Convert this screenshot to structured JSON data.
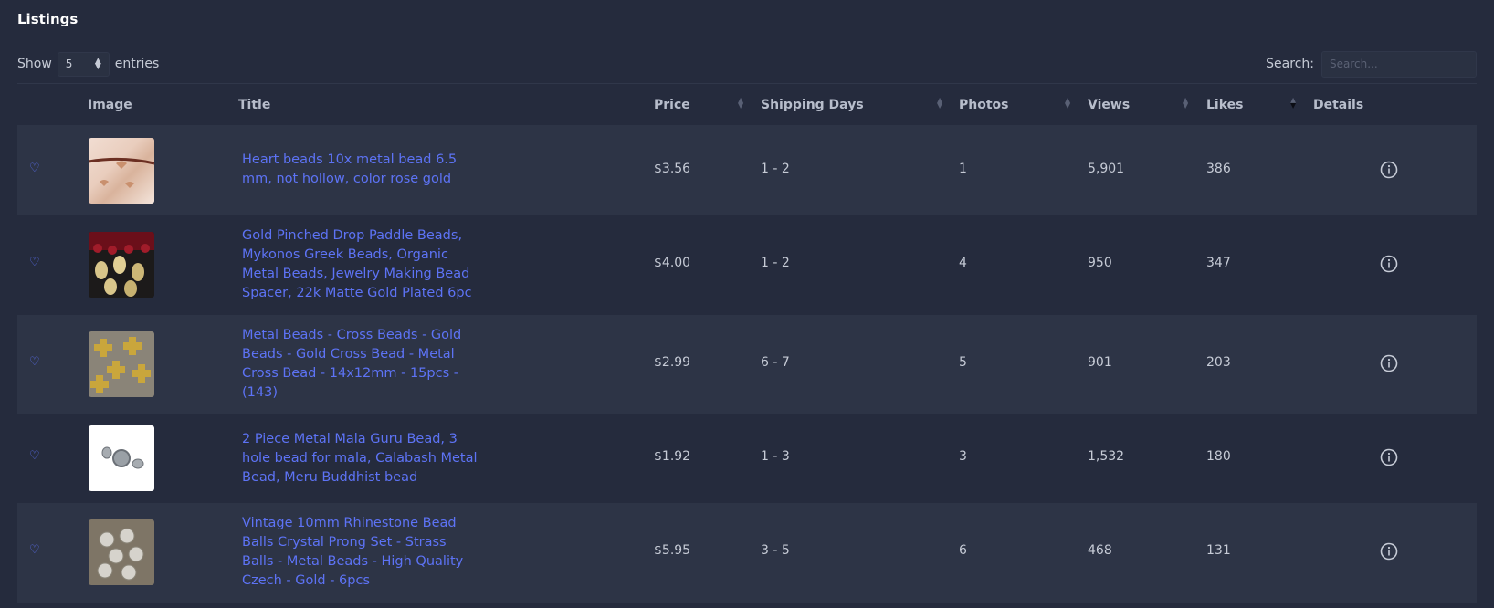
{
  "page": {
    "title": "Listings"
  },
  "controls": {
    "show_label": "Show",
    "entries_value": "5",
    "entries_label": "entries",
    "search_label": "Search:",
    "search_placeholder": "Search..."
  },
  "columns": {
    "image": "Image",
    "title": "Title",
    "price": "Price",
    "shipping": "Shipping Days",
    "photos": "Photos",
    "views": "Views",
    "likes": "Likes",
    "details": "Details"
  },
  "rows": [
    {
      "title": "Heart beads 10x metal bead 6.5 mm, not hollow, color rose gold",
      "price": "$3.56",
      "shipping": "1 - 2",
      "photos": "1",
      "views": "5,901",
      "likes": "386"
    },
    {
      "title": "Gold Pinched Drop Paddle Beads, Mykonos Greek Beads, Organic Metal Beads, Jewelry Making Bead Spacer, 22k Matte Gold Plated 6pc",
      "price": "$4.00",
      "shipping": "1 - 2",
      "photos": "4",
      "views": "950",
      "likes": "347"
    },
    {
      "title": "Metal Beads - Cross Beads - Gold Beads - Gold Cross Bead - Metal Cross Bead - 14x12mm - 15pcs - (143)",
      "price": "$2.99",
      "shipping": "6 - 7",
      "photos": "5",
      "views": "901",
      "likes": "203"
    },
    {
      "title": "2 Piece Metal Mala Guru Bead, 3 hole bead for mala, Calabash Metal Bead, Meru Buddhist bead",
      "price": "$1.92",
      "shipping": "1 - 3",
      "photos": "3",
      "views": "1,532",
      "likes": "180"
    },
    {
      "title": "Vintage 10mm Rhinestone Bead Balls Crystal Prong Set - Strass Balls - Metal Beads - High Quality Czech - Gold - 6pcs",
      "price": "$5.95",
      "shipping": "3 - 5",
      "photos": "6",
      "views": "468",
      "likes": "131"
    }
  ],
  "icons": {
    "favorite": "heart-outline-icon",
    "details": "info-circle-icon",
    "sort": "sort-arrows-icon"
  },
  "colors": {
    "background": "#252b3d",
    "row_alt": "#2d3446",
    "link": "#5d73f5"
  }
}
